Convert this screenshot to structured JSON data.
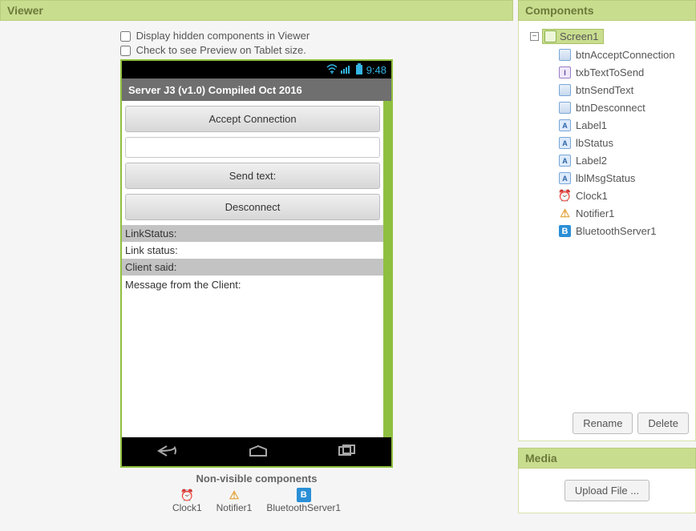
{
  "viewer": {
    "title": "Viewer",
    "opt_hidden": "Display hidden components in Viewer",
    "opt_tablet": "Check to see Preview on Tablet size.",
    "clock": "9:48",
    "screen_title": "Server J3 (v1.0) Compiled Oct 2016",
    "btn_accept": "Accept Connection",
    "btn_send": "Send text:",
    "btn_disc": "Desconnect",
    "lbl_linkstatus_hdr": "LinkStatus:",
    "lbl_linkstatus_val": "Link status:",
    "lbl_client_hdr": "Client said:",
    "lbl_msg": "Message from the Client:",
    "nonvis_title": "Non-visible components",
    "nv_clock": "Clock1",
    "nv_notifier": "Notifier1",
    "nv_bt": "BluetoothServer1"
  },
  "components": {
    "title": "Components",
    "root": "Screen1",
    "items": [
      {
        "icon": "button",
        "label": "btnAcceptConnection"
      },
      {
        "icon": "textbox",
        "label": "txbTextToSend"
      },
      {
        "icon": "button",
        "label": "btnSendText"
      },
      {
        "icon": "button",
        "label": "btnDesconnect"
      },
      {
        "icon": "label",
        "label": "Label1"
      },
      {
        "icon": "label",
        "label": "lbStatus"
      },
      {
        "icon": "label",
        "label": "Label2"
      },
      {
        "icon": "label",
        "label": "lblMsgStatus"
      },
      {
        "icon": "clock",
        "label": "Clock1"
      },
      {
        "icon": "notif",
        "label": "Notifier1"
      },
      {
        "icon": "bt",
        "label": "BluetoothServer1"
      }
    ],
    "btn_rename": "Rename",
    "btn_delete": "Delete"
  },
  "media": {
    "title": "Media",
    "btn_upload": "Upload File ..."
  }
}
